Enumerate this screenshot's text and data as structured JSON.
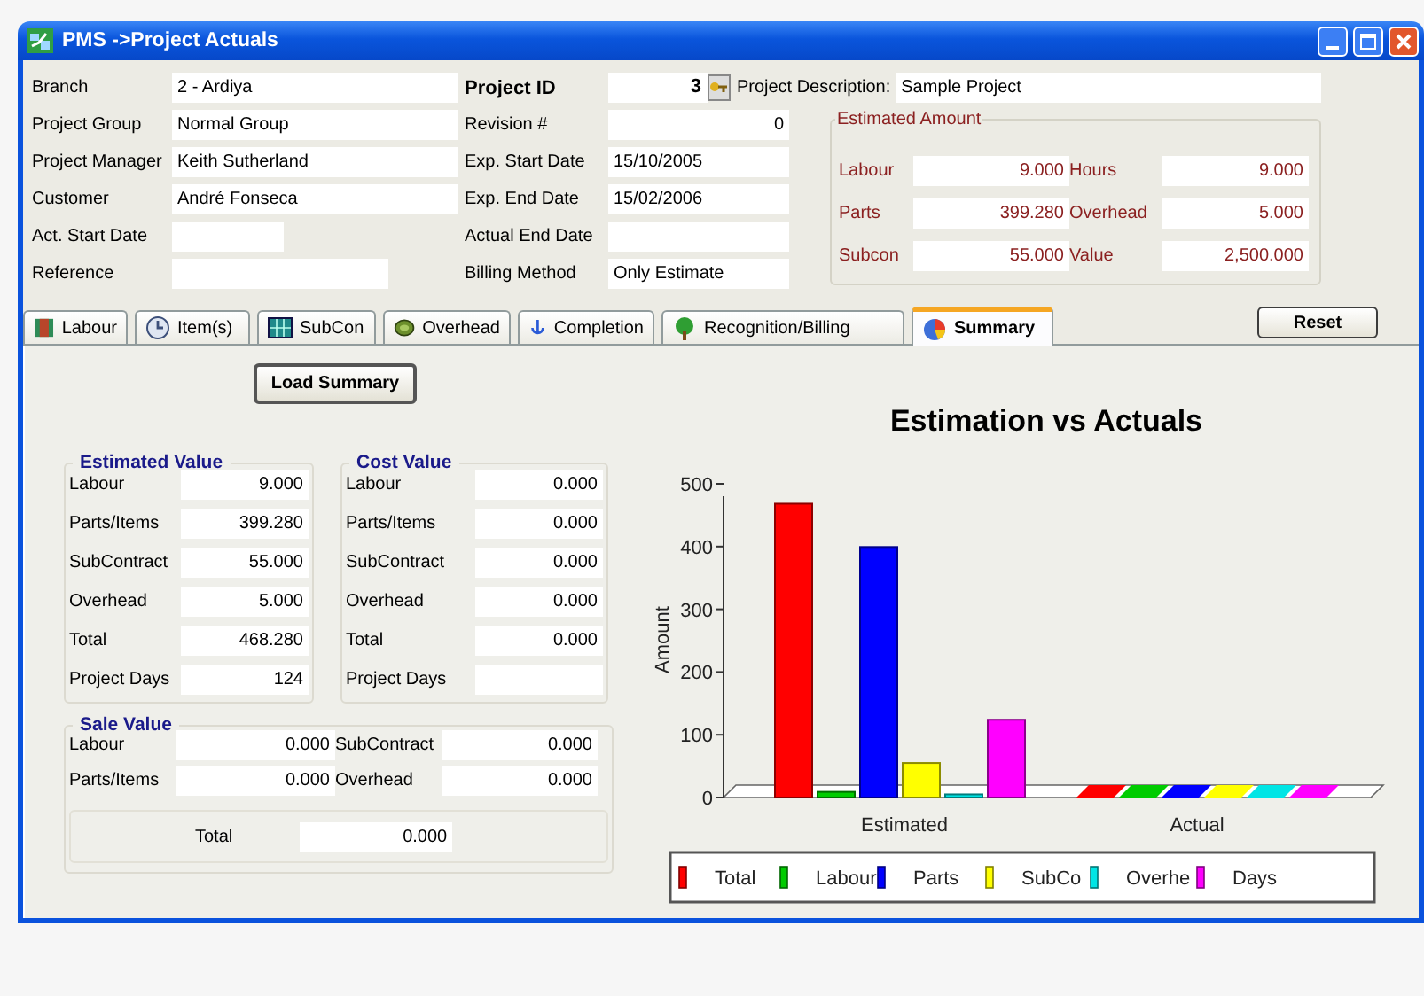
{
  "window": {
    "title": "PMS ->Project Actuals"
  },
  "header": {
    "left_fields": [
      {
        "label": "Branch",
        "value": "2 - Ardiya"
      },
      {
        "label": "Project Group",
        "value": "Normal Group"
      },
      {
        "label": "Project Manager",
        "value": "Keith Sutherland"
      },
      {
        "label": "Customer",
        "value": "André Fonseca"
      },
      {
        "label": "Act. Start Date"
      },
      {
        "label": "Reference"
      }
    ],
    "right_fields": [
      {
        "label": "Project ID",
        "value": "3",
        "kind": "id"
      },
      {
        "label": "Revision #",
        "value": "0",
        "kind": "number"
      },
      {
        "label": "Exp. Start Date",
        "value": "15/10/2005",
        "kind": "text"
      },
      {
        "label": "Exp. End Date",
        "value": "15/02/2006",
        "kind": "text"
      },
      {
        "label": "Actual End Date",
        "kind": "text"
      },
      {
        "label": "Billing Method",
        "value": "Only Estimate",
        "kind": "text"
      }
    ],
    "description": {
      "label": "Project Description:",
      "value": "Sample Project"
    },
    "estimated_amount": {
      "title": "Estimated Amount",
      "items": [
        {
          "label": "Labour",
          "value": "9.000"
        },
        {
          "label": "Hours",
          "value": "9.000"
        },
        {
          "label": "Parts",
          "value": "399.280"
        },
        {
          "label": "Overhead",
          "value": "5.000"
        },
        {
          "label": "Subcon",
          "value": "55.000"
        },
        {
          "label": "Value",
          "value": "2,500.000"
        }
      ]
    }
  },
  "tabs": [
    {
      "label": "Labour",
      "selected": false
    },
    {
      "label": "Item(s)",
      "selected": false
    },
    {
      "label": "SubCon",
      "selected": false
    },
    {
      "label": "Overhead",
      "selected": false
    },
    {
      "label": "Completion",
      "selected": false
    },
    {
      "label": "Recognition/Billing",
      "selected": false
    },
    {
      "label": "Summary",
      "selected": true
    }
  ],
  "reset_button": "Reset",
  "summary": {
    "load_button": "Load Summary",
    "estimated_value": {
      "title": "Estimated Value",
      "rows": [
        {
          "label": "Labour",
          "value": "9.000"
        },
        {
          "label": "Parts/Items",
          "value": "399.280"
        },
        {
          "label": "SubContract",
          "value": "55.000"
        },
        {
          "label": "Overhead",
          "value": "5.000"
        },
        {
          "label": "Total",
          "value": "468.280"
        },
        {
          "label": "Project Days",
          "value": "124"
        }
      ]
    },
    "cost_value": {
      "title": "Cost Value",
      "rows": [
        {
          "label": "Labour",
          "value": "0.000"
        },
        {
          "label": "Parts/Items",
          "value": "0.000"
        },
        {
          "label": "SubContract",
          "value": "0.000"
        },
        {
          "label": "Overhead",
          "value": "0.000"
        },
        {
          "label": "Total",
          "value": "0.000"
        },
        {
          "label": "Project Days"
        }
      ]
    },
    "sale_value": {
      "title": "Sale Value",
      "rows": [
        {
          "label": "Labour",
          "value": "0.000"
        },
        {
          "label": "SubContract",
          "value": "0.000"
        },
        {
          "label": "Parts/Items",
          "value": "0.000"
        },
        {
          "label": "Overhead",
          "value": "0.000"
        }
      ],
      "total": {
        "label": "Total",
        "value": "0.000"
      }
    },
    "chart_data": {
      "type": "bar",
      "title": "Estimation vs Actuals",
      "legend": "bottom",
      "ylabel": "Amount",
      "categories": [
        "Estimated",
        "Actual"
      ],
      "ylim": [
        0,
        500
      ],
      "yticks": [
        0,
        100,
        200,
        300,
        400,
        500
      ],
      "series": [
        {
          "name": "Total",
          "color": "#ff0000",
          "values": [
            468.28,
            0
          ]
        },
        {
          "name": "Labour",
          "color": "#00cc00",
          "values": [
            9,
            0
          ]
        },
        {
          "name": "Parts",
          "color": "#0000ff",
          "values": [
            399.28,
            0
          ]
        },
        {
          "name": "SubCo",
          "color": "#ffff00",
          "values": [
            55,
            0
          ]
        },
        {
          "name": "Overhe",
          "color": "#00e5e5",
          "values": [
            5,
            0
          ]
        },
        {
          "name": "Days",
          "color": "#ff00ff",
          "values": [
            124,
            0
          ]
        }
      ]
    }
  }
}
